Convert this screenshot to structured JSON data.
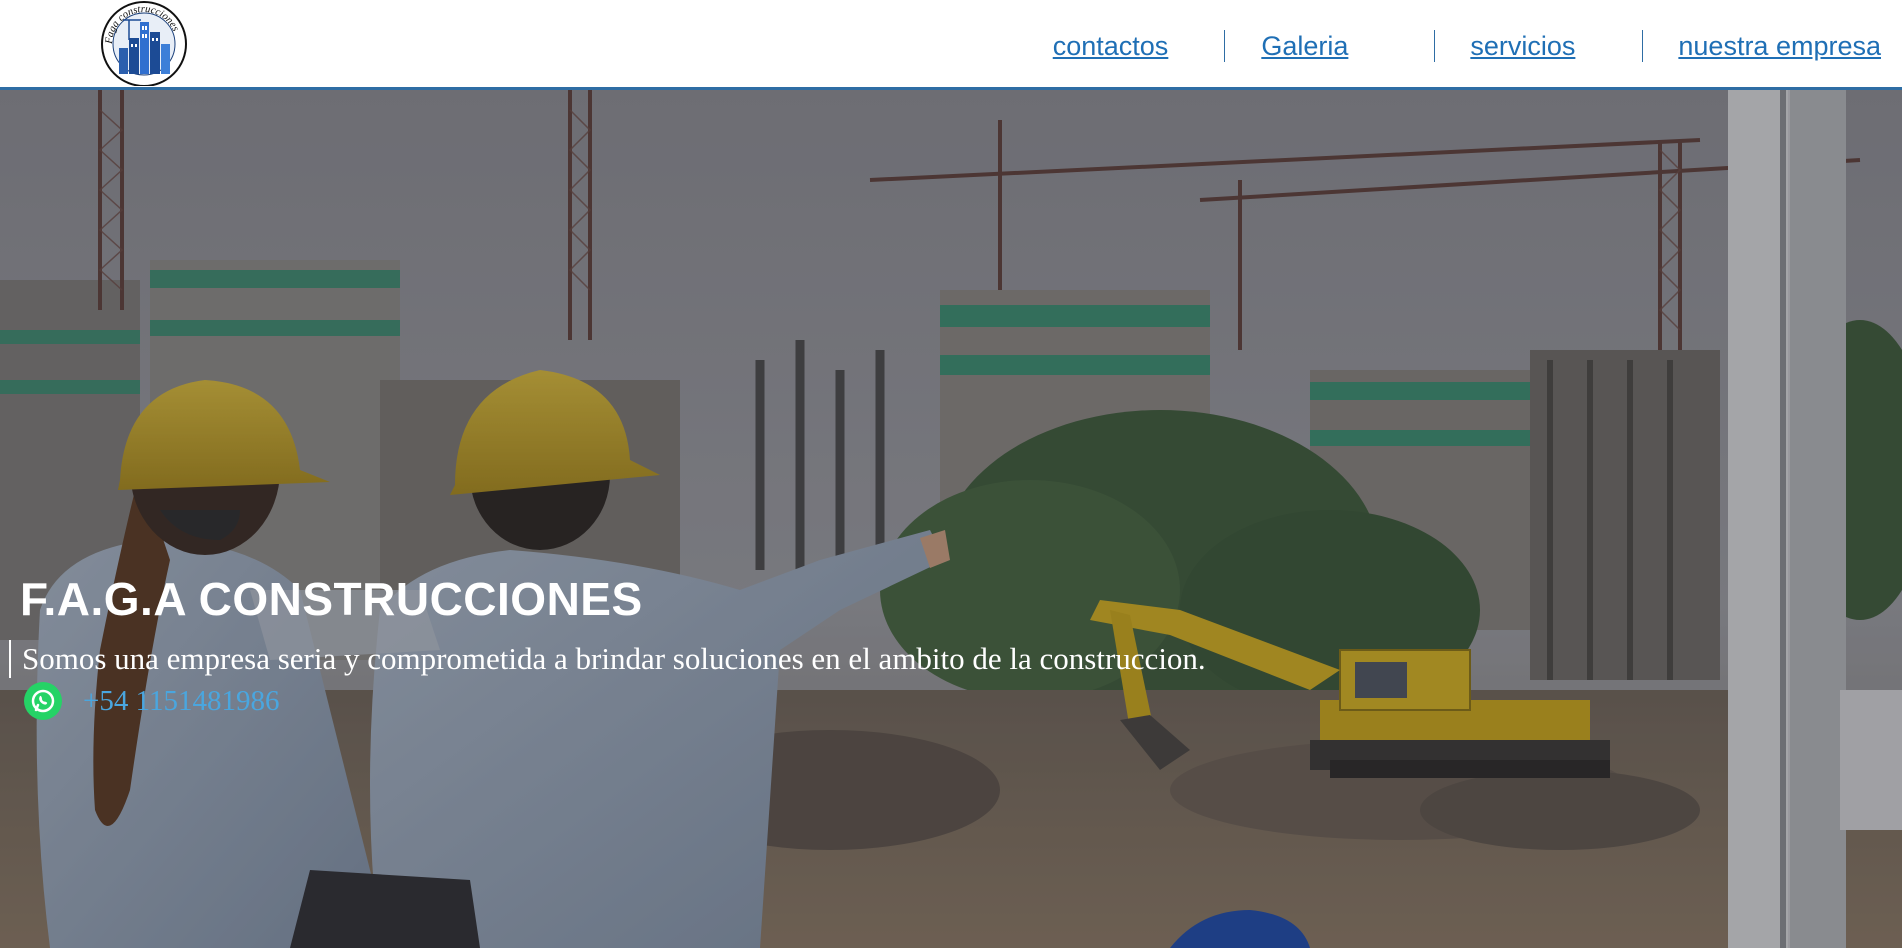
{
  "header": {
    "logo_text": "Faga construcciones",
    "nav": [
      {
        "label": "contactos"
      },
      {
        "label": "Galeria"
      },
      {
        "label": "servicios"
      },
      {
        "label": "nuestra empresa"
      }
    ],
    "accent_color": "#2e6da4"
  },
  "hero": {
    "title": "F.A.G.A CONSTRUCCIONES",
    "tagline": "Somos una empresa seria y comprometida a brindar soluciones en el ambito de la construccion.",
    "phone": "+54 1151481986",
    "whatsapp_icon": "whatsapp-icon",
    "background_image": "construction-site-photo"
  }
}
